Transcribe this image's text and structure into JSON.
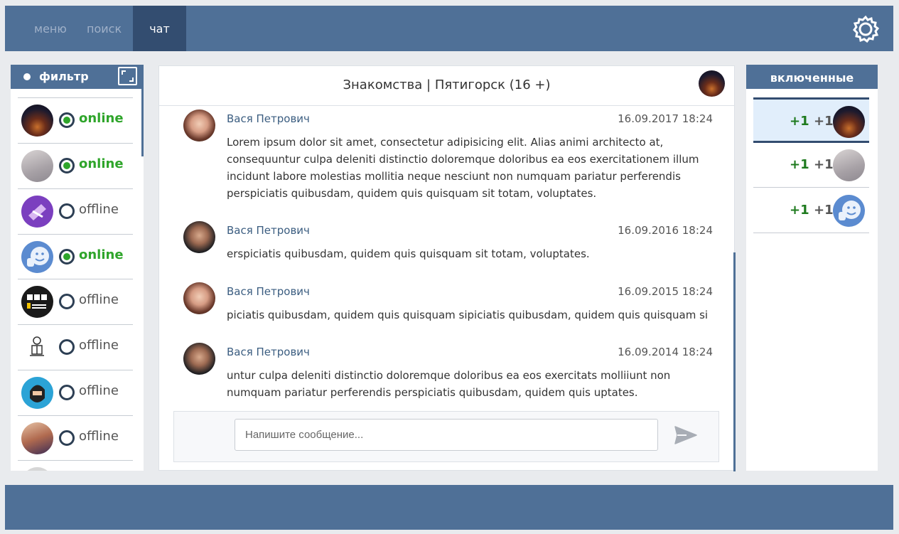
{
  "nav": {
    "menu": "меню",
    "search": "поиск",
    "chat": "чат",
    "settings_icon": "gear-icon"
  },
  "filter": {
    "label": "фильтр",
    "expand_icon": "expand-icon"
  },
  "contacts": [
    {
      "status": "online",
      "online": true,
      "avatar": "night-city"
    },
    {
      "status": "online",
      "online": true,
      "avatar": "book-cover"
    },
    {
      "status": "offline",
      "online": false,
      "avatar": "purple-tools"
    },
    {
      "status": "online",
      "online": true,
      "avatar": "smile-like"
    },
    {
      "status": "offline",
      "online": false,
      "avatar": "bbc-national-geographic"
    },
    {
      "status": "offline",
      "online": false,
      "avatar": "logo-emblem"
    },
    {
      "status": "offline",
      "online": false,
      "avatar": "bearded-man"
    },
    {
      "status": "offline",
      "online": false,
      "avatar": "woman-photo"
    }
  ],
  "chat": {
    "title": "Знакомства | Пятигорск (16 +)",
    "messages": [
      {
        "author": "Вася Петрович",
        "time": "16.09.2017 18:24",
        "text": "Lorem ipsum dolor sit amet, consectetur adipisicing elit. Alias animi architecto at, consequuntur culpa deleniti distinctio doloremque doloribus ea eos exercitationem illum incidunt labore molestias mollitia neque nesciunt non numquam pariatur perferendis perspiciatis quibusdam, quidem quis quisquam sit totam, voluptates."
      },
      {
        "author": "Вася Петрович",
        "time": "16.09.2016 18:24",
        "text": "erspiciatis quibusdam, quidem quis quisquam sit totam, voluptates."
      },
      {
        "author": "Вася Петрович",
        "time": "16.09.2015 18:24",
        "text": "piciatis quibusdam, quidem quis quisquam sipiciatis quibusdam, quidem quis quisquam si"
      },
      {
        "author": "Вася Петрович",
        "time": "16.09.2014 18:24",
        "text": "untur culpa deleniti distinctio doloremque doloribus ea eos exercitats molliiunt non numquam pariatur perferendis perspiciatis quibusdam, quidem quis uptates."
      }
    ],
    "composer": {
      "placeholder": "Напишите сообщение...",
      "send_icon": "send-icon"
    }
  },
  "included": {
    "header": "включенные",
    "items": [
      {
        "a": "+1",
        "b": "+1",
        "avatar": "night-city",
        "active": true
      },
      {
        "a": "+1",
        "b": "+1",
        "avatar": "book-cover",
        "active": false
      },
      {
        "a": "+1",
        "b": "+1",
        "avatar": "smile-like",
        "active": false
      }
    ]
  },
  "colors": {
    "bar": "#4f7097",
    "bar_active": "#334d70",
    "online": "#2fa52b",
    "plus_green": "#1e7a1e"
  }
}
